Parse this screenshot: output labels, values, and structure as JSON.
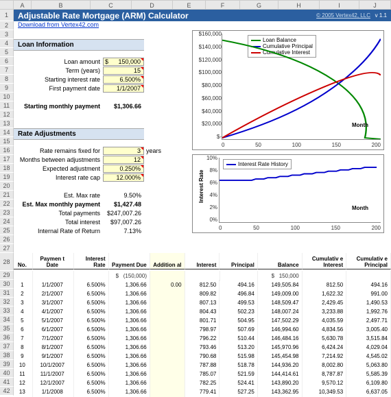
{
  "app": {
    "title": "Adjustable Rate Mortgage (ARM) Calculator",
    "copyright": "© 2005 Vertex42, LLC",
    "version": "v 1.1",
    "download_link": "Download from Vertex42.com"
  },
  "columns_letters": [
    "A",
    "B",
    "C",
    "D",
    "E",
    "F",
    "G",
    "H",
    "I",
    "J"
  ],
  "loan_info": {
    "section": "Loan Information",
    "amount_label": "Loan amount",
    "amount": "150,000",
    "amount_prefix": "$",
    "term_label": "Term (years)",
    "term": "15",
    "start_rate_label": "Starting interest rate",
    "start_rate": "6.500%",
    "first_date_label": "First payment date",
    "first_date": "1/1/2007",
    "start_pmt_label": "Starting monthly payment",
    "start_pmt": "$1,306.66"
  },
  "rate_adj": {
    "section": "Rate Adjustments",
    "fixed_label": "Rate remains fixed for",
    "fixed": "3",
    "fixed_unit": "years",
    "months_label": "Months between adjustments",
    "months": "12",
    "expected_label": "Expected adjustment",
    "expected": "0.250%",
    "cap_label": "Interest rate cap",
    "cap": "12.000%",
    "maxrate_label": "Est. Max rate",
    "maxrate": "9.50%",
    "maxpmt_label": "Est. Max monthly payment",
    "maxpmt": "$1,427.48",
    "totpmt_label": "Total payments",
    "totpmt": "$247,007.26",
    "totint_label": "Total interest",
    "totint": "$97,007.26",
    "irr_label": "Internal Rate of Return",
    "irr": "7.13%"
  },
  "headers": {
    "no": "No.",
    "date": "Paymen\nt Date",
    "rate": "Interest Rate",
    "due": "Payment Due",
    "add": "Addition\nal",
    "int": "Interest",
    "prin": "Principal",
    "bal": "Balance",
    "cint": "Cumulativ\ne Interest",
    "cprin": "Cumulativ\ne Principal"
  },
  "start_row": {
    "due": "(150,000)",
    "bal": "150,000"
  },
  "chart_data": [
    {
      "type": "line",
      "title": "",
      "xlabel": "Month",
      "ylabel": "$",
      "ylim": [
        0,
        160000
      ],
      "xlim": [
        0,
        200
      ],
      "yticks": [
        "$160,000",
        "$140,000",
        "$120,000",
        "$100,000",
        "$80,000",
        "$60,000",
        "$40,000",
        "$20,000",
        "$-"
      ],
      "xticks": [
        "0",
        "50",
        "100",
        "150",
        "200"
      ],
      "series": [
        {
          "name": "Loan Balance",
          "color": "#008800"
        },
        {
          "name": "Cumulative Principal",
          "color": "#0000cc"
        },
        {
          "name": "Cumulative Interest",
          "color": "#cc0000"
        }
      ]
    },
    {
      "type": "line",
      "title": "",
      "xlabel": "Month",
      "ylabel": "Interest Rate",
      "ylim": [
        0,
        10
      ],
      "xlim": [
        0,
        200
      ],
      "yticks": [
        "10%",
        "8%",
        "6%",
        "4%",
        "2%",
        "0%"
      ],
      "xticks": [
        "0",
        "50",
        "100",
        "150",
        "200"
      ],
      "series": [
        {
          "name": "Interest Rate History",
          "color": "#0000cc"
        }
      ]
    }
  ],
  "schedule": [
    {
      "n": "1",
      "d": "1/1/2007",
      "r": "6.500%",
      "due": "1,306.66",
      "add": "0.00",
      "i": "812.50",
      "p": "494.16",
      "b": "149,505.84",
      "ci": "812.50",
      "cp": "494.16"
    },
    {
      "n": "2",
      "d": "2/1/2007",
      "r": "6.500%",
      "due": "1,306.66",
      "add": "",
      "i": "809.82",
      "p": "496.84",
      "b": "149,009.00",
      "ci": "1,622.32",
      "cp": "991.00"
    },
    {
      "n": "3",
      "d": "3/1/2007",
      "r": "6.500%",
      "due": "1,306.66",
      "add": "",
      "i": "807.13",
      "p": "499.53",
      "b": "148,509.47",
      "ci": "2,429.45",
      "cp": "1,490.53"
    },
    {
      "n": "4",
      "d": "4/1/2007",
      "r": "6.500%",
      "due": "1,306.66",
      "add": "",
      "i": "804.43",
      "p": "502.23",
      "b": "148,007.24",
      "ci": "3,233.88",
      "cp": "1,992.76"
    },
    {
      "n": "5",
      "d": "5/1/2007",
      "r": "6.500%",
      "due": "1,306.66",
      "add": "",
      "i": "801.71",
      "p": "504.95",
      "b": "147,502.29",
      "ci": "4,035.59",
      "cp": "2,497.71"
    },
    {
      "n": "6",
      "d": "6/1/2007",
      "r": "6.500%",
      "due": "1,306.66",
      "add": "",
      "i": "798.97",
      "p": "507.69",
      "b": "146,994.60",
      "ci": "4,834.56",
      "cp": "3,005.40"
    },
    {
      "n": "7",
      "d": "7/1/2007",
      "r": "6.500%",
      "due": "1,306.66",
      "add": "",
      "i": "796.22",
      "p": "510.44",
      "b": "146,484.16",
      "ci": "5,630.78",
      "cp": "3,515.84"
    },
    {
      "n": "8",
      "d": "8/1/2007",
      "r": "6.500%",
      "due": "1,306.66",
      "add": "",
      "i": "793.46",
      "p": "513.20",
      "b": "145,970.96",
      "ci": "6,424.24",
      "cp": "4,029.04"
    },
    {
      "n": "9",
      "d": "9/1/2007",
      "r": "6.500%",
      "due": "1,306.66",
      "add": "",
      "i": "790.68",
      "p": "515.98",
      "b": "145,454.98",
      "ci": "7,214.92",
      "cp": "4,545.02"
    },
    {
      "n": "10",
      "d": "10/1/2007",
      "r": "6.500%",
      "due": "1,306.66",
      "add": "",
      "i": "787.88",
      "p": "518.78",
      "b": "144,936.20",
      "ci": "8,002.80",
      "cp": "5,063.80"
    },
    {
      "n": "11",
      "d": "11/1/2007",
      "r": "6.500%",
      "due": "1,306.66",
      "add": "",
      "i": "785.07",
      "p": "521.59",
      "b": "144,414.61",
      "ci": "8,787.87",
      "cp": "5,585.39"
    },
    {
      "n": "12",
      "d": "12/1/2007",
      "r": "6.500%",
      "due": "1,306.66",
      "add": "",
      "i": "782.25",
      "p": "524.41",
      "b": "143,890.20",
      "ci": "9,570.12",
      "cp": "6,109.80"
    },
    {
      "n": "13",
      "d": "1/1/2008",
      "r": "6.500%",
      "due": "1,306.66",
      "add": "",
      "i": "779.41",
      "p": "527.25",
      "b": "143,362.95",
      "ci": "10,349.53",
      "cp": "6,637.05"
    }
  ]
}
